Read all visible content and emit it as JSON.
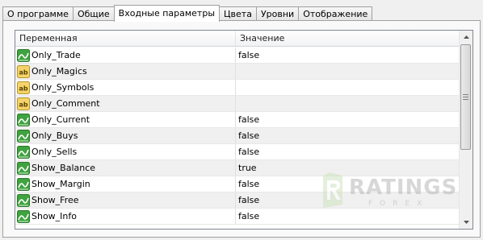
{
  "tabs": [
    {
      "label": "О программе",
      "active": false
    },
    {
      "label": "Общие",
      "active": false
    },
    {
      "label": "Входные параметры",
      "active": true
    },
    {
      "label": "Цвета",
      "active": false
    },
    {
      "label": "Уровни",
      "active": false
    },
    {
      "label": "Отображение",
      "active": false
    }
  ],
  "grid": {
    "columns": {
      "variable": "Переменная",
      "value": "Значение"
    },
    "rows": [
      {
        "name": "Only_Trade",
        "value": "false",
        "type": "bool"
      },
      {
        "name": "Only_Magics",
        "value": "",
        "type": "string"
      },
      {
        "name": "Only_Symbols",
        "value": "",
        "type": "string"
      },
      {
        "name": "Only_Comment",
        "value": "",
        "type": "string"
      },
      {
        "name": "Only_Current",
        "value": "false",
        "type": "bool"
      },
      {
        "name": "Only_Buys",
        "value": "false",
        "type": "bool"
      },
      {
        "name": "Only_Sells",
        "value": "false",
        "type": "bool"
      },
      {
        "name": "Show_Balance",
        "value": "true",
        "type": "bool"
      },
      {
        "name": "Show_Margin",
        "value": "false",
        "type": "bool"
      },
      {
        "name": "Show_Free",
        "value": "false",
        "type": "bool"
      },
      {
        "name": "Show_Info",
        "value": "false",
        "type": "bool"
      }
    ]
  },
  "icons": {
    "bool": "bool-param-icon",
    "string": "string-param-icon",
    "string_glyph": "ab"
  },
  "watermark": {
    "logo_letter": "R",
    "text": "RATINGS",
    "sub": "FOREX"
  },
  "colors": {
    "bool_icon_bg": "#3fa33f",
    "string_icon_bg": "#f3d36a",
    "row_alt": "#f0f0f0",
    "watermark": "#b7b7b7"
  }
}
